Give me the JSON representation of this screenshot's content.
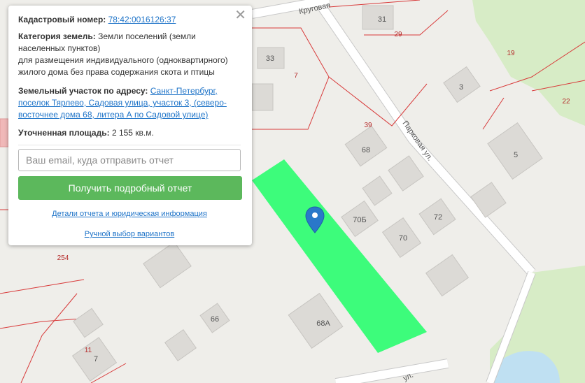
{
  "map": {
    "parcel_fill": "#3dfc7b",
    "boundary_color": "#d83a3a",
    "building_labels": [
      "31",
      "33",
      "3",
      "68",
      "5",
      "70Б",
      "72",
      "70",
      "66",
      "68А",
      "7"
    ],
    "plot_labels": [
      "29",
      "7",
      "19",
      "22",
      "39",
      "254",
      "11"
    ],
    "streets": [
      "Круговая",
      "Парковая ул.",
      "ул."
    ],
    "marker": "location-pin-icon"
  },
  "popup": {
    "cad_label": "Кадастровый номер:",
    "cad_value": "78:42:0016126:37",
    "category_label": "Категория земель:",
    "category_line1": "Земли поселений (земли",
    "category_line2": "населенных пунктов)",
    "category_line3": "для размещения индивидуального (одноквартирного)",
    "category_line4": "жилого дома без права содержания скота и птицы",
    "address_label": "Земельный участок по адресу:",
    "address_line1": "Санкт-Петербург,",
    "address_line2": "поселок Тярлево, Садовая улица, участок 3, (северо-",
    "address_line3": "восточнее дома 68, литера А по Садовой улице)",
    "area_label": "Уточненная площадь:",
    "area_value": "2 155 кв.м.",
    "email_placeholder": "Ваш email, куда отправить отчет",
    "report_button": "Получить подробный отчет",
    "details_link": "Детали отчета и юридическая информация",
    "manual_link": "Ручной выбор вариантов",
    "close_symbol": "✕"
  }
}
